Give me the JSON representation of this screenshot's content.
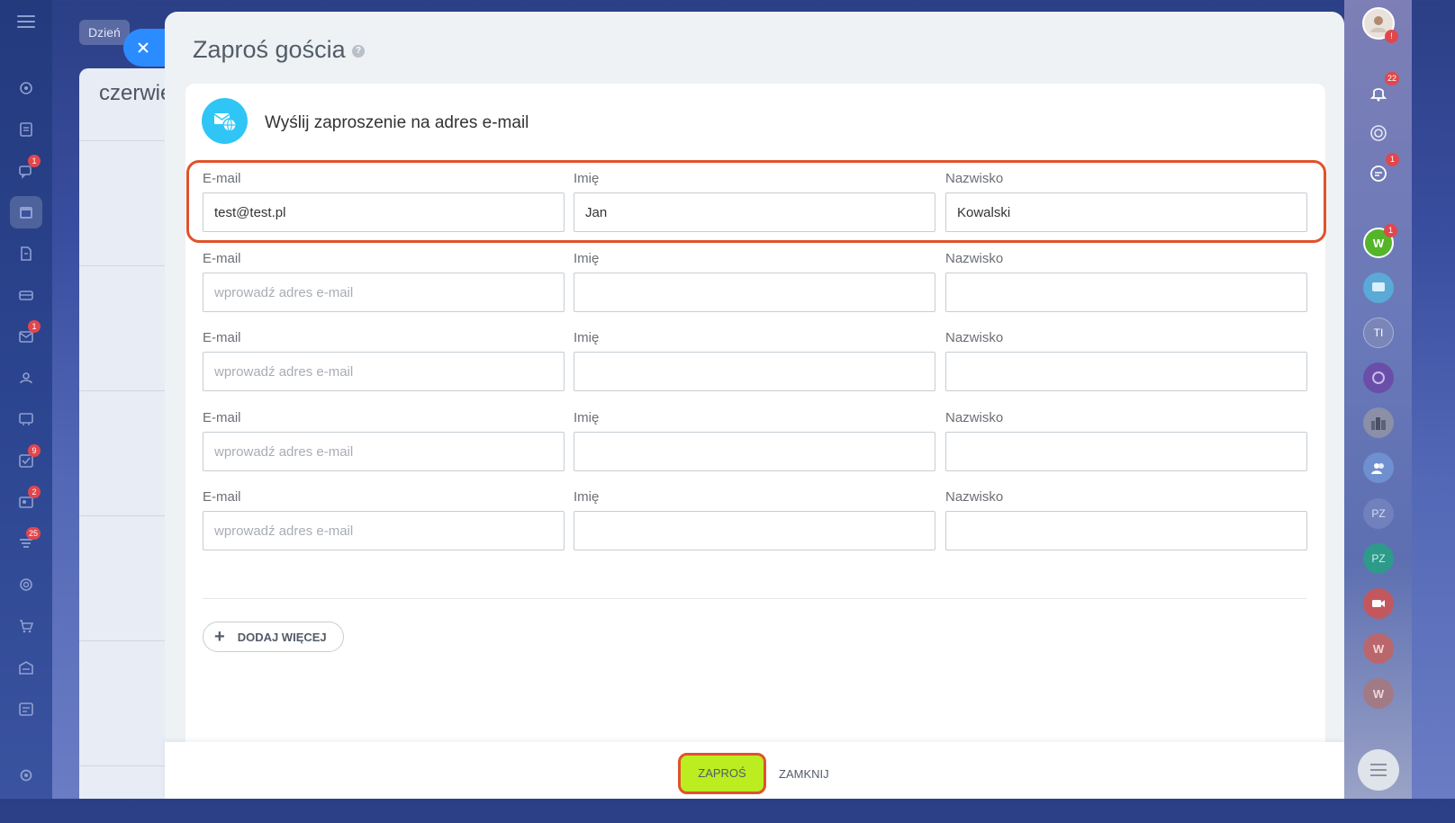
{
  "background": {
    "tab_label": "Dzień",
    "month_label": "czerwie"
  },
  "left_sidebar": {
    "badges": {
      "messages": "1",
      "mail": "1",
      "tasks": "9",
      "contacts": "2",
      "pipeline": "25"
    }
  },
  "dialog": {
    "title": "Zaproś gościa",
    "help": "?",
    "section_title": "Wyślij zaproszenie na adres e-mail",
    "labels": {
      "email": "E-mail",
      "first_name": "Imię",
      "last_name": "Nazwisko"
    },
    "email_placeholder": "wprowadź adres e-mail",
    "rows": [
      {
        "email": "test@test.pl",
        "first_name": "Jan",
        "last_name": "Kowalski"
      },
      {
        "email": "",
        "first_name": "",
        "last_name": ""
      },
      {
        "email": "",
        "first_name": "",
        "last_name": ""
      },
      {
        "email": "",
        "first_name": "",
        "last_name": ""
      },
      {
        "email": "",
        "first_name": "",
        "last_name": ""
      }
    ],
    "add_more_label": "DODAJ WIĘCEJ",
    "invite_label": "ZAPROŚ",
    "close_label": "ZAMKNIJ"
  },
  "right_sidebar": {
    "notifications_count": "22",
    "chat_badge": "1",
    "w_badge": "1",
    "avatars": [
      "W",
      "TI",
      "PZ",
      "PZ",
      "W",
      "W"
    ]
  },
  "colors": {
    "accent_blue": "#2b8cff",
    "highlight_border": "#e0522a",
    "invite_button": "#bbed21",
    "section_icon": "#2fc6f6",
    "badge_red": "#e0474c"
  }
}
